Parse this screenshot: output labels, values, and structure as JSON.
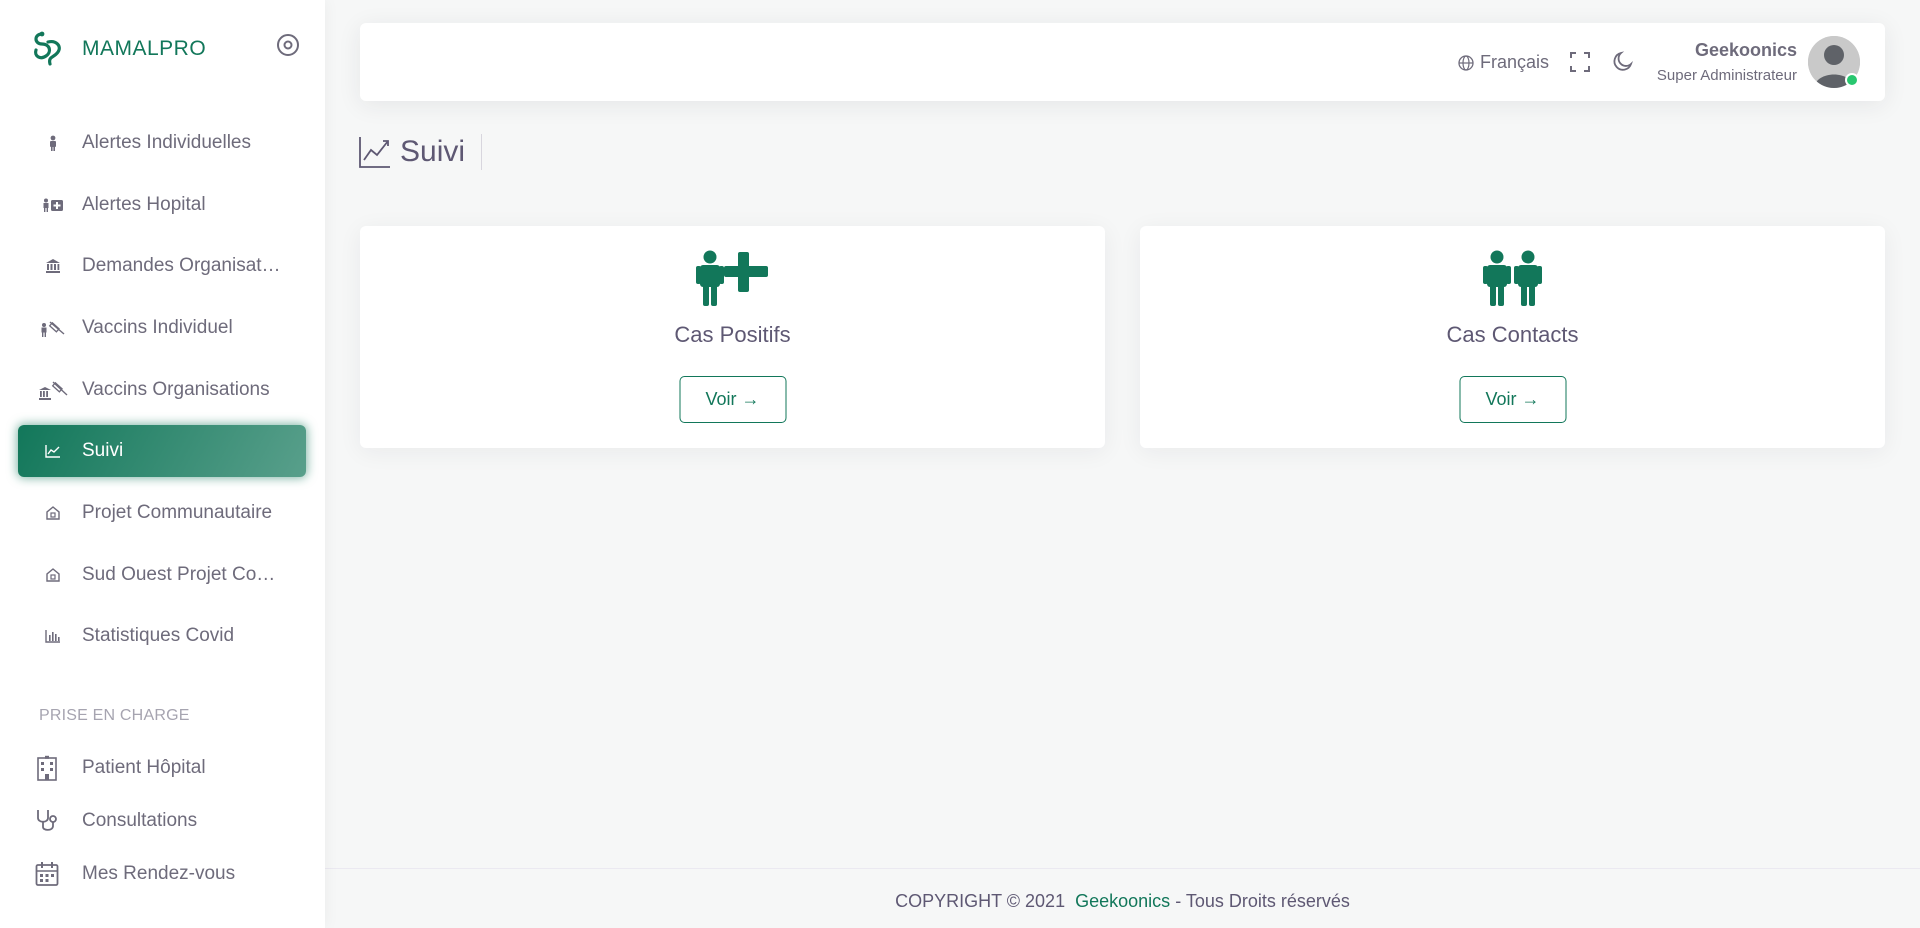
{
  "brand": {
    "name": "MAMALPRO",
    "color": "#12775a"
  },
  "sidebar": {
    "items": [
      {
        "label": "Alertes Individuelles",
        "icon": "person-icon",
        "active": false
      },
      {
        "label": "Alertes Hopital",
        "icon": "person-hospital-icon",
        "active": false
      },
      {
        "label": "Demandes Organisat…",
        "icon": "bank-icon",
        "active": false
      },
      {
        "label": "Vaccins Individuel",
        "icon": "person-syringe-icon",
        "active": false
      },
      {
        "label": "Vaccins Organisations",
        "icon": "bank-syringe-icon",
        "active": false
      },
      {
        "label": "Suivi",
        "icon": "line-chart-icon",
        "active": true
      },
      {
        "label": "Projet Communautaire",
        "icon": "home-icon",
        "active": false
      },
      {
        "label": "Sud Ouest Projet Co…",
        "icon": "home-icon",
        "active": false
      },
      {
        "label": "Statistiques Covid",
        "icon": "bar-chart-icon",
        "active": false
      }
    ],
    "section_title": "PRISE EN CHARGE",
    "section_items": [
      {
        "label": "Patient Hôpital",
        "icon": "building-icon"
      },
      {
        "label": "Consultations",
        "icon": "stethoscope-icon"
      },
      {
        "label": "Mes Rendez-vous",
        "icon": "calendar-icon"
      }
    ]
  },
  "header": {
    "language": "Français",
    "user_name": "Geekoonics",
    "user_role": "Super Administrateur",
    "status_color": "#28c76f"
  },
  "page": {
    "title": "Suivi"
  },
  "cards": [
    {
      "title": "Cas Positifs",
      "button": "Voir →",
      "icon": "person-plus-icon"
    },
    {
      "title": "Cas Contacts",
      "button": "Voir →",
      "icon": "two-persons-icon"
    }
  ],
  "footer": {
    "prefix": "COPYRIGHT © 2021",
    "company": "Geekoonics",
    "suffix": "- Tous Droits réservés"
  }
}
